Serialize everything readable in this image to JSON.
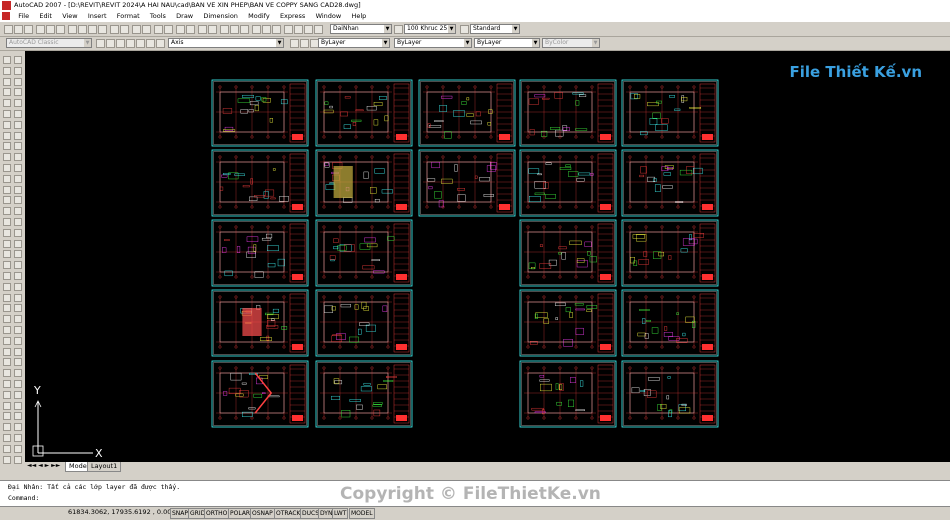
{
  "window": {
    "title": "AutoCAD 2007 - [D:\\REVIT\\REVIT 2024\\A HAI NAU\\cad\\BAN VE XIN PHEP\\BAN VE COPPY SANG CAD28.dwg]"
  },
  "menu": [
    "File",
    "Edit",
    "View",
    "Insert",
    "Format",
    "Tools",
    "Draw",
    "Dimension",
    "Modify",
    "Express",
    "Window",
    "Help"
  ],
  "toolbar1": {
    "text_style": "DaiNhan",
    "dim_style": "100 Khruc 25",
    "table_style": "Standard"
  },
  "toolbar2": {
    "workspace": "AutoCAD Classic",
    "layer": "Axis",
    "color": "ByLayer",
    "linetype": "ByLayer",
    "lineweight": "ByLayer",
    "plotstyle": "ByColor"
  },
  "logo": {
    "text": "File Thiết Kế.vn"
  },
  "ucs": {
    "x": "X",
    "y": "Y"
  },
  "tabs": [
    "Model",
    "Layout1"
  ],
  "command": {
    "history": "Đại Nhân: Tất cả các lớp layer đã được thấy.",
    "prompt": "Command:"
  },
  "status": {
    "coords": "61834.3062, 17935.6192 , 0.0000",
    "buttons": [
      "SNAP",
      "GRID",
      "ORTHO",
      "POLAR",
      "OSNAP",
      "OTRACK",
      "DUCS",
      "DYN",
      "LWT",
      "MODEL"
    ]
  },
  "watermark": "Copyright © FileThietKe.vn"
}
